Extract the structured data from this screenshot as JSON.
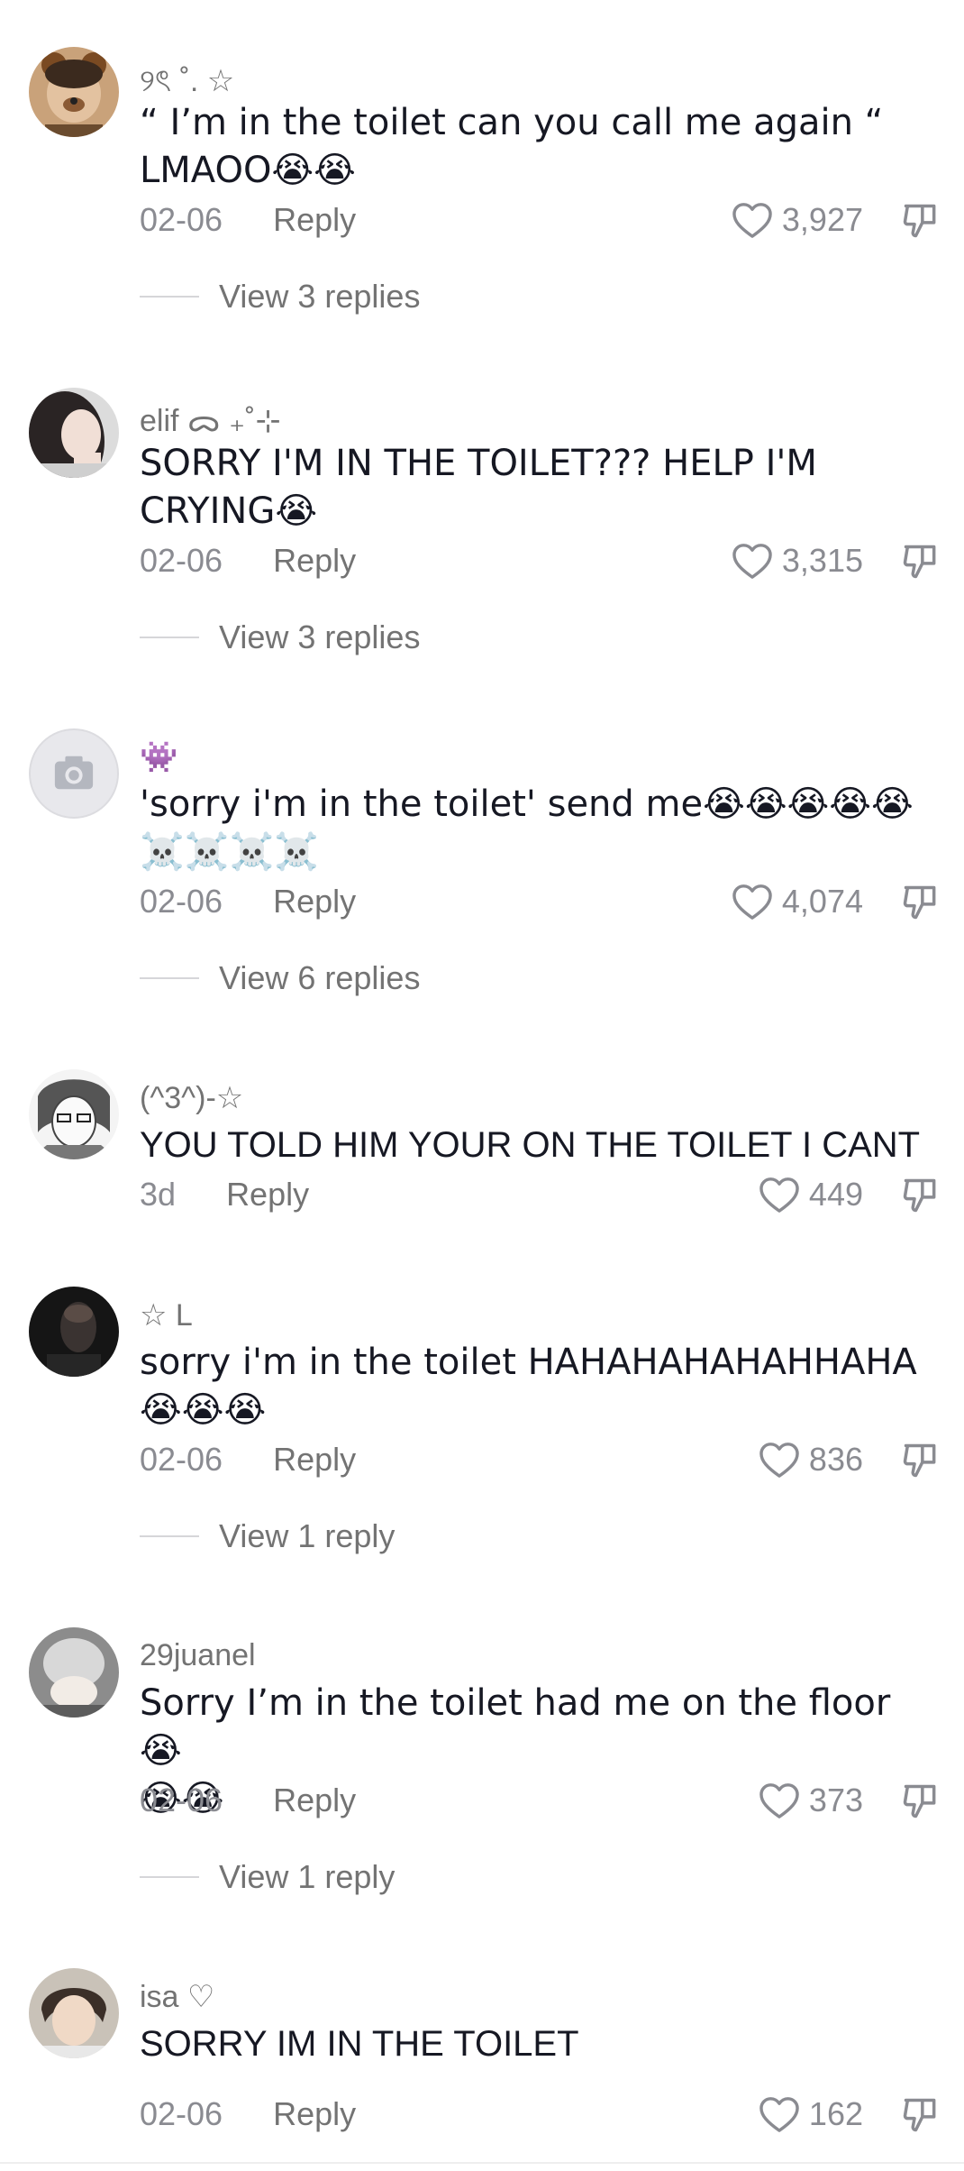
{
  "comments": [
    {
      "username": "୨ৎ ˚. ☆",
      "text": "“ I’m in the toilet can you call me again “\nLMAOO😭😭",
      "date": "02-06",
      "reply_label": "Reply",
      "likes": "3,927",
      "view_replies": "View 3 replies"
    },
    {
      "username": "elif ᯅ ₊˚⊹",
      "text": "SORRY I'M IN THE TOILET??? HELP I'M\nCRYING😭",
      "date": "02-06",
      "reply_label": "Reply",
      "likes": "3,315",
      "view_replies": "View 3 replies"
    },
    {
      "username": "👾",
      "text": "'sorry i'm in the toilet' send me😭😭😭😭😭\n☠️☠️☠️☠️",
      "date": "02-06",
      "reply_label": "Reply",
      "likes": "4,074",
      "view_replies": "View 6 replies"
    },
    {
      "username": "(^3^)-☆",
      "text": "YOU TOLD HIM YOUR ON THE TOILET I CANT",
      "date": "3d",
      "reply_label": "Reply",
      "likes": "449",
      "view_replies": ""
    },
    {
      "username": "☆ L",
      "text": "sorry i'm in the toilet HAHAHAHAHAHHAHA\n😭😭😭",
      "date": "02-06",
      "reply_label": "Reply",
      "likes": "836",
      "view_replies": "View 1 reply"
    },
    {
      "username": "29juanel",
      "text": "Sorry I’m in the toilet had me on the floor 😭\n😭😭",
      "date": "02-06",
      "reply_label": "Reply",
      "likes": "373",
      "view_replies": "View 1 reply"
    },
    {
      "username": "isa ♡",
      "text": "SORRY IM IN THE TOILET",
      "date": "02-06",
      "reply_label": "Reply",
      "likes": "162",
      "view_replies": ""
    }
  ],
  "icons": {
    "like": "heart-outline-icon",
    "dislike": "thumbs-down-outline-icon",
    "placeholder_avatar": "camera-icon"
  },
  "colors": {
    "username": "#737373",
    "meta": "#8a8b91",
    "text": "#161823"
  }
}
